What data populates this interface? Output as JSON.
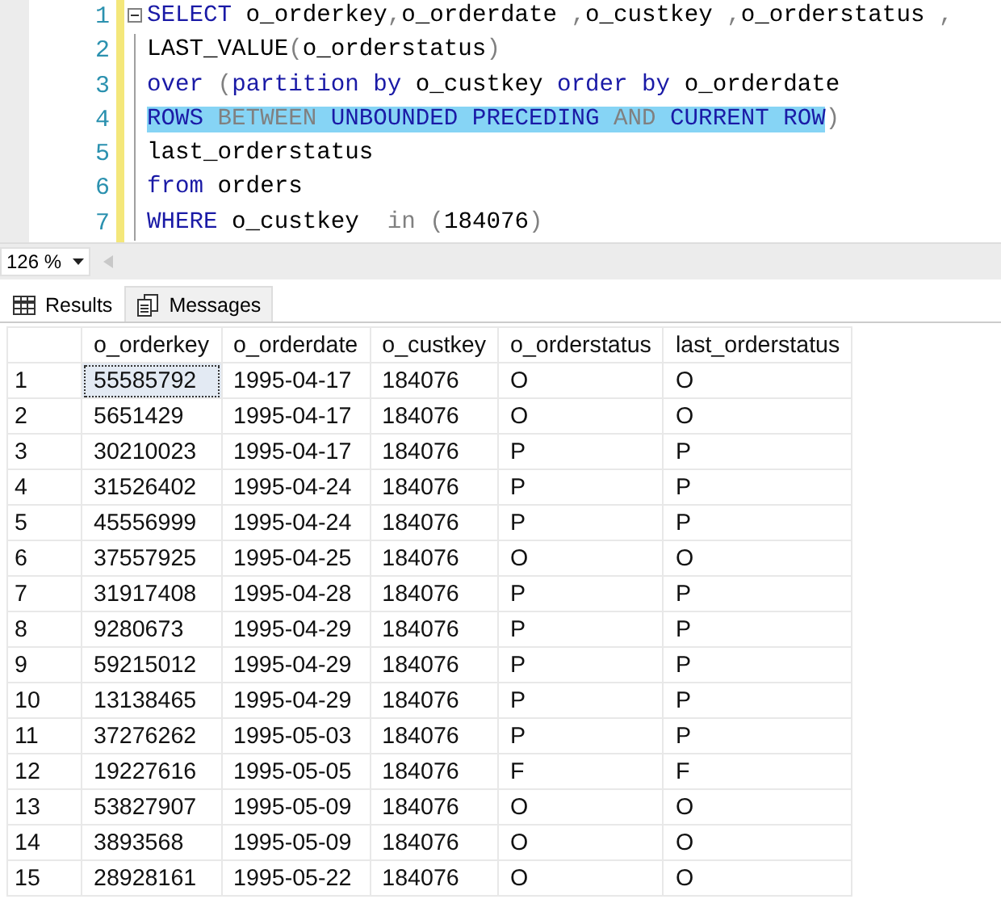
{
  "editor": {
    "lines": [
      {
        "number": "1",
        "selected": false,
        "tokens": [
          {
            "text": "SELECT",
            "kind": "keyword"
          },
          {
            "text": " o_orderkey",
            "kind": "plain"
          },
          {
            "text": ",",
            "kind": "gray"
          },
          {
            "text": "o_orderdate ",
            "kind": "plain"
          },
          {
            "text": ",",
            "kind": "gray"
          },
          {
            "text": "o_custkey ",
            "kind": "plain"
          },
          {
            "text": ",",
            "kind": "gray"
          },
          {
            "text": "o_orderstatus ",
            "kind": "plain"
          },
          {
            "text": ",",
            "kind": "gray"
          }
        ]
      },
      {
        "number": "2",
        "selected": false,
        "tokens": [
          {
            "text": "LAST_VALUE",
            "kind": "plain"
          },
          {
            "text": "(",
            "kind": "gray"
          },
          {
            "text": "o_orderstatus",
            "kind": "plain"
          },
          {
            "text": ")",
            "kind": "gray"
          }
        ]
      },
      {
        "number": "3",
        "selected": false,
        "tokens": [
          {
            "text": "over ",
            "kind": "keyword"
          },
          {
            "text": "(",
            "kind": "gray"
          },
          {
            "text": "partition by ",
            "kind": "keyword"
          },
          {
            "text": "o_custkey ",
            "kind": "plain"
          },
          {
            "text": "order by ",
            "kind": "keyword"
          },
          {
            "text": "o_orderdate",
            "kind": "plain"
          }
        ]
      },
      {
        "number": "4",
        "selected": true,
        "tokens": [
          {
            "text": "ROWS ",
            "kind": "keyword"
          },
          {
            "text": "BETWEEN ",
            "kind": "gray"
          },
          {
            "text": "UNBOUNDED PRECEDING ",
            "kind": "keyword"
          },
          {
            "text": "AND ",
            "kind": "gray"
          },
          {
            "text": "CURRENT ROW",
            "kind": "keyword"
          }
        ],
        "after": [
          {
            "text": ")",
            "kind": "gray"
          }
        ]
      },
      {
        "number": "5",
        "selected": false,
        "tokens": [
          {
            "text": "last_orderstatus",
            "kind": "plain"
          }
        ]
      },
      {
        "number": "6",
        "selected": false,
        "tokens": [
          {
            "text": "from ",
            "kind": "keyword"
          },
          {
            "text": "orders",
            "kind": "plain"
          }
        ]
      },
      {
        "number": "7",
        "selected": false,
        "tokens": [
          {
            "text": "WHERE ",
            "kind": "keyword"
          },
          {
            "text": "o_custkey  ",
            "kind": "plain"
          },
          {
            "text": "in ",
            "kind": "gray"
          },
          {
            "text": "(",
            "kind": "gray"
          },
          {
            "text": "184076",
            "kind": "plain"
          },
          {
            "text": ")",
            "kind": "gray"
          }
        ]
      }
    ]
  },
  "zoom": {
    "value": "126 %"
  },
  "tabs": [
    {
      "label": "Results",
      "selected": true
    },
    {
      "label": "Messages",
      "selected": false
    }
  ],
  "table": {
    "columns": [
      "o_orderkey",
      "o_orderdate",
      "o_custkey",
      "o_orderstatus",
      "last_orderstatus"
    ],
    "rows": [
      {
        "number": "1",
        "selected": true,
        "cells": [
          "55585792",
          "1995-04-17",
          "184076",
          "O",
          "O"
        ]
      },
      {
        "number": "2",
        "selected": false,
        "cells": [
          "5651429",
          "1995-04-17",
          "184076",
          "O",
          "O"
        ]
      },
      {
        "number": "3",
        "selected": false,
        "cells": [
          "30210023",
          "1995-04-17",
          "184076",
          "P",
          "P"
        ]
      },
      {
        "number": "4",
        "selected": false,
        "cells": [
          "31526402",
          "1995-04-24",
          "184076",
          "P",
          "P"
        ]
      },
      {
        "number": "5",
        "selected": false,
        "cells": [
          "45556999",
          "1995-04-24",
          "184076",
          "P",
          "P"
        ]
      },
      {
        "number": "6",
        "selected": false,
        "cells": [
          "37557925",
          "1995-04-25",
          "184076",
          "O",
          "O"
        ]
      },
      {
        "number": "7",
        "selected": false,
        "cells": [
          "31917408",
          "1995-04-28",
          "184076",
          "P",
          "P"
        ]
      },
      {
        "number": "8",
        "selected": false,
        "cells": [
          "9280673",
          "1995-04-29",
          "184076",
          "P",
          "P"
        ]
      },
      {
        "number": "9",
        "selected": false,
        "cells": [
          "59215012",
          "1995-04-29",
          "184076",
          "P",
          "P"
        ]
      },
      {
        "number": "10",
        "selected": false,
        "cells": [
          "13138465",
          "1995-04-29",
          "184076",
          "P",
          "P"
        ]
      },
      {
        "number": "11",
        "selected": false,
        "cells": [
          "37276262",
          "1995-05-03",
          "184076",
          "P",
          "P"
        ]
      },
      {
        "number": "12",
        "selected": false,
        "cells": [
          "19227616",
          "1995-05-05",
          "184076",
          "F",
          "F"
        ]
      },
      {
        "number": "13",
        "selected": false,
        "cells": [
          "53827907",
          "1995-05-09",
          "184076",
          "O",
          "O"
        ]
      },
      {
        "number": "14",
        "selected": false,
        "cells": [
          "3893568",
          "1995-05-09",
          "184076",
          "O",
          "O"
        ]
      },
      {
        "number": "15",
        "selected": false,
        "cells": [
          "28928161",
          "1995-05-22",
          "184076",
          "O",
          "O"
        ]
      }
    ]
  }
}
